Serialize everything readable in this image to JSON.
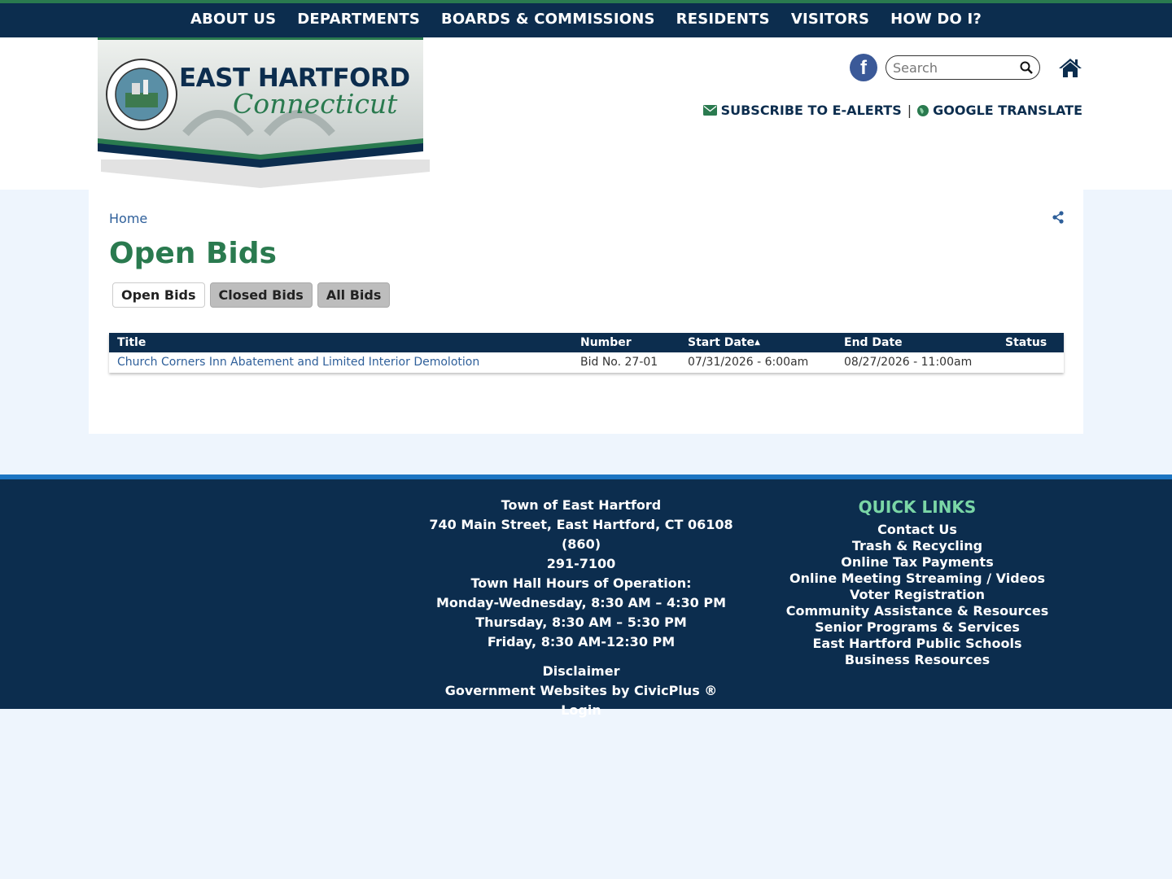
{
  "nav": [
    "ABOUT US",
    "DEPARTMENTS",
    "BOARDS & COMMISSIONS",
    "RESIDENTS",
    "VISITORS",
    "HOW DO I?"
  ],
  "logo": {
    "title": "EAST HARTFORD",
    "script": "Connecticut",
    "seal_text": "TOWN OF EAST HARTFORD CONNECTICUT"
  },
  "header": {
    "search_placeholder": "Search",
    "subscribe": "SUBSCRIBE TO E-ALERTS",
    "separator": "|",
    "translate": "GOOGLE TRANSLATE"
  },
  "breadcrumb": "Home",
  "page_title": "Open Bids",
  "tabs": [
    {
      "label": "Open Bids",
      "active": true
    },
    {
      "label": "Closed Bids",
      "active": false
    },
    {
      "label": "All Bids",
      "active": false
    }
  ],
  "table": {
    "headers": [
      "Title",
      "Number",
      "Start Date",
      "End Date",
      "Status"
    ],
    "sort_indicator": "▲",
    "rows": [
      {
        "title": "Church Corners Inn Abatement and Limited Interior Demolotion",
        "number": "Bid No. 27-01",
        "start": "07/31/2026 - 6:00am",
        "end": "08/27/2026 - 11:00am",
        "status": ""
      }
    ]
  },
  "footer": {
    "address_lines": [
      "Town of East Hartford",
      "740 Main Street, East Hartford, CT 06108  (860)",
      "291-7100",
      "Town Hall Hours of Operation:",
      "Monday-Wednesday, 8:30 AM – 4:30 PM",
      "Thursday, 8:30 AM – 5:30 PM",
      "Friday, 8:30 AM-12:30 PM"
    ],
    "links": [
      "Disclaimer",
      "Government Websites by CivicPlus ®",
      "Login"
    ],
    "quick_links_title": "QUICK LINKS",
    "quick_links": [
      "Contact Us",
      "Trash & Recycling",
      "Online Tax Payments",
      "Online Meeting Streaming / Videos",
      "Voter Registration",
      "Community Assistance & Resources",
      "Senior Programs & Services",
      "East Hartford Public Schools",
      "Business Resources"
    ]
  },
  "colors": {
    "navy": "#0c2d4e",
    "green": "#2a7a4f",
    "link": "#2e5f9a",
    "footer_accent": "#1d75c2",
    "quick_links_title": "#7ad6a6"
  }
}
